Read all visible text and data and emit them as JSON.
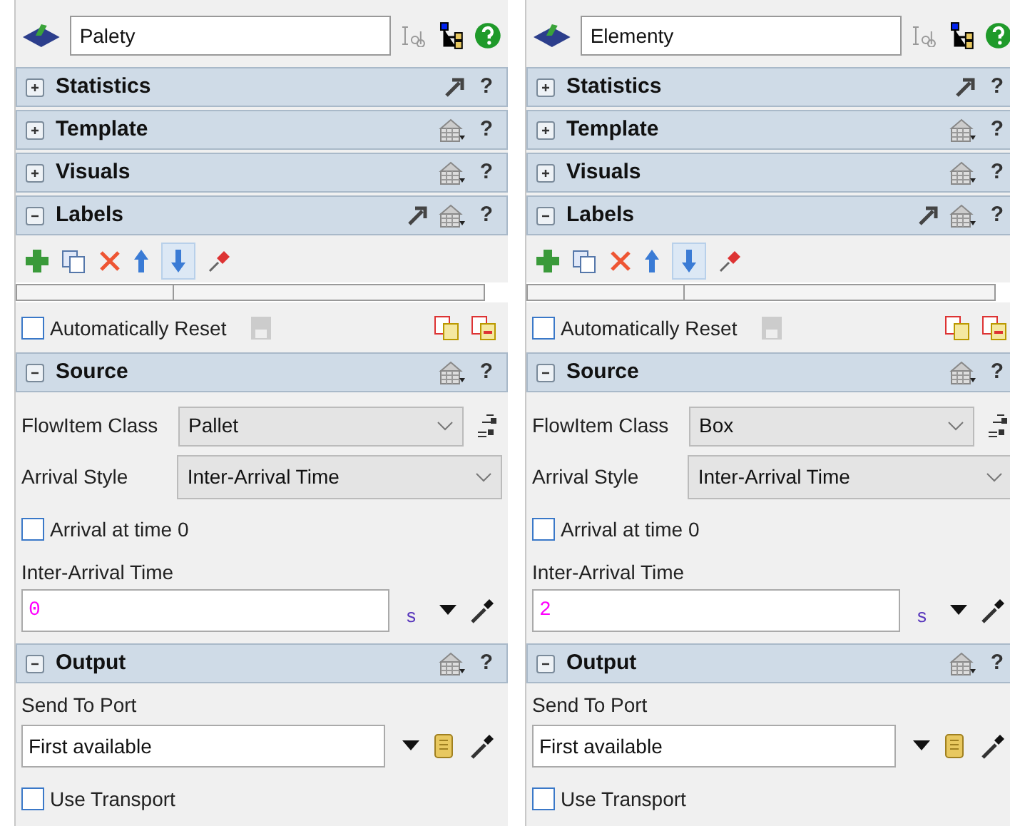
{
  "panels": [
    {
      "name": "Palety",
      "sections_top": [
        {
          "title": "Statistics",
          "expanded": false,
          "tools": [
            {
              "kind": "arrow"
            }
          ],
          "help": "?"
        },
        {
          "title": "Template",
          "expanded": false,
          "tools": [
            {
              "kind": "table"
            }
          ],
          "help": "?"
        },
        {
          "title": "Visuals",
          "expanded": false,
          "tools": [
            {
              "kind": "table"
            }
          ],
          "help": "?"
        },
        {
          "title": "Labels",
          "expanded": true,
          "tools": [
            {
              "kind": "arrow"
            },
            {
              "kind": "table"
            }
          ],
          "help": "?"
        }
      ],
      "auto_reset": {
        "label": "Automatically Reset",
        "checked": false
      },
      "source": {
        "title": "Source",
        "expanded": true,
        "tools": [
          {
            "kind": "table"
          }
        ],
        "help": "?",
        "flowitem_label": "FlowItem Class",
        "flowitem_value": "Pallet",
        "arrival_label": "Arrival Style",
        "arrival_value": "Inter-Arrival Time",
        "time0": {
          "label": "Arrival at time 0",
          "checked": false
        },
        "interarrival_label": "Inter-Arrival Time",
        "interarrival_value": "0",
        "unit": "s"
      },
      "output": {
        "title": "Output",
        "expanded": true,
        "tools": [
          {
            "kind": "table"
          }
        ],
        "help": "?",
        "port_label": "Send To Port",
        "port_value": "First available",
        "transport": {
          "label": "Use Transport",
          "checked": false
        }
      }
    },
    {
      "name": "Elementy",
      "sections_top": [
        {
          "title": "Statistics",
          "expanded": false,
          "tools": [
            {
              "kind": "arrow"
            }
          ],
          "help": "?"
        },
        {
          "title": "Template",
          "expanded": false,
          "tools": [
            {
              "kind": "table"
            }
          ],
          "help": "?"
        },
        {
          "title": "Visuals",
          "expanded": false,
          "tools": [
            {
              "kind": "table"
            }
          ],
          "help": "?"
        },
        {
          "title": "Labels",
          "expanded": true,
          "tools": [
            {
              "kind": "arrow"
            },
            {
              "kind": "table"
            }
          ],
          "help": "?"
        }
      ],
      "auto_reset": {
        "label": "Automatically Reset",
        "checked": false
      },
      "source": {
        "title": "Source",
        "expanded": true,
        "tools": [
          {
            "kind": "table"
          }
        ],
        "help": "?",
        "flowitem_label": "FlowItem Class",
        "flowitem_value": "Box",
        "arrival_label": "Arrival Style",
        "arrival_value": "Inter-Arrival Time",
        "time0": {
          "label": "Arrival at time 0",
          "checked": false
        },
        "interarrival_label": "Inter-Arrival Time",
        "interarrival_value": "2",
        "unit": "s"
      },
      "output": {
        "title": "Output",
        "expanded": true,
        "tools": [
          {
            "kind": "table"
          }
        ],
        "help": "?",
        "port_label": "Send To Port",
        "port_value": "First available",
        "transport": {
          "label": "Use Transport",
          "checked": false
        }
      }
    }
  ]
}
